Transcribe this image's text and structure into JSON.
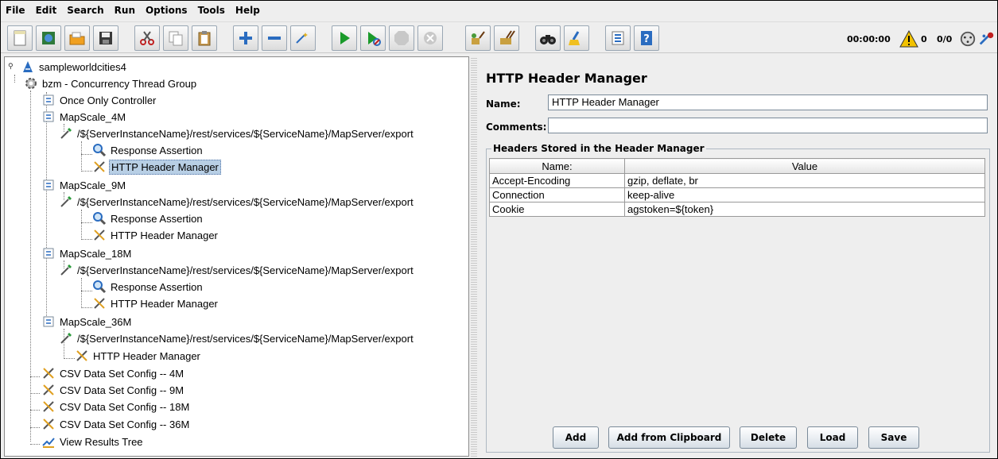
{
  "menu": [
    {
      "id": "file",
      "label": "File"
    },
    {
      "id": "edit",
      "label": "Edit"
    },
    {
      "id": "search",
      "label": "Search"
    },
    {
      "id": "run",
      "label": "Run"
    },
    {
      "id": "options",
      "label": "Options"
    },
    {
      "id": "tools",
      "label": "Tools"
    },
    {
      "id": "help",
      "label": "Help"
    }
  ],
  "status": {
    "timer": "00:00:00",
    "warning_count": "0",
    "threads": "0/0"
  },
  "tree": {
    "root": "sampleworldcities4",
    "thread_group": "bzm - Concurrency Thread Group",
    "once_only": "Once Only Controller",
    "scale_4m": "MapScale_4M",
    "scale_9m": "MapScale_9M",
    "scale_18m": "MapScale_18M",
    "scale_36m": "MapScale_36M",
    "sampler_path": "/${ServerInstanceName}/rest/services/${ServiceName}/MapServer/export",
    "response_assertion": "Response Assertion",
    "header_manager": "HTTP Header Manager",
    "csv_4m": "CSV Data Set Config -- 4M",
    "csv_9m": "CSV Data Set Config -- 9M",
    "csv_18m": "CSV Data Set Config -- 18M",
    "csv_36m": "CSV Data Set Config -- 36M",
    "results_tree": "View Results Tree"
  },
  "panel": {
    "title": "HTTP Header Manager",
    "name_label": "Name:",
    "name_value": "HTTP Header Manager",
    "comments_label": "Comments:",
    "comments_value": "",
    "group_title": "Headers Stored in the Header Manager",
    "columns": [
      "Name:",
      "Value"
    ],
    "rows": [
      [
        "Accept-Encoding",
        "gzip, deflate, br"
      ],
      [
        "Connection",
        "keep-alive"
      ],
      [
        "Cookie",
        "agstoken=${token}"
      ]
    ],
    "buttons": {
      "add": "Add",
      "add_clipboard": "Add from Clipboard",
      "delete": "Delete",
      "load": "Load",
      "save": "Save"
    }
  }
}
